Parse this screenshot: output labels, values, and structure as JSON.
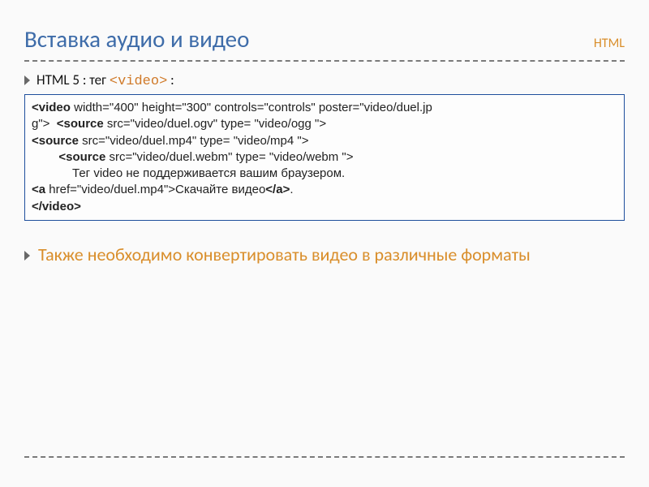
{
  "header": {
    "title": "Вставка аудио и видео",
    "badge": "HTML"
  },
  "bullet1": {
    "prefix": "HTML 5 : тег ",
    "tag": "<video>",
    "suffix": " :"
  },
  "code": {
    "l1a": "<video",
    "l1b": " width=\"400\" height=\"300\" controls=\"controls\" poster=\"video/duel.jp",
    "l2a": "g\">  ",
    "l2b": "<source",
    "l2c": " src=\"video/duel.ogv\" type= \"video/ogg \">",
    "l3a": "<source",
    "l3b": " src=\"video/duel.mp4\" type= \"video/mp4 \">",
    "l4a": "        ",
    "l4b": "<source",
    "l4c": " src=\"video/duel.webm\" type= \"video/webm \">",
    "l5": "            Тег video не поддерживается вашим браузером.",
    "l6a": "<a",
    "l6b": " href=\"video/duel.mp4\">Скачайте видео",
    "l6c": "</a>",
    "l6d": ".",
    "l7": "</video>"
  },
  "bullet2": {
    "text": "Также необходимо конвертировать видео в различные форматы"
  }
}
